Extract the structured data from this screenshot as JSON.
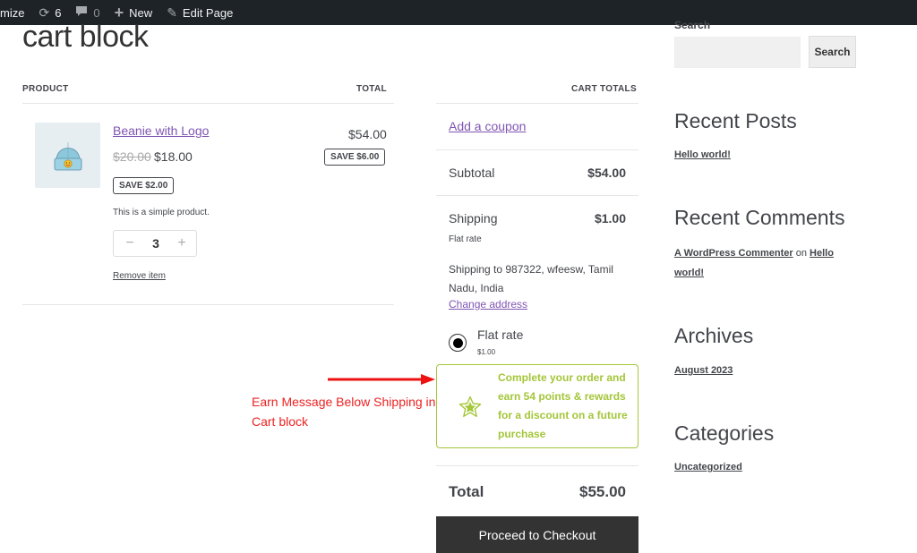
{
  "admin_bar": {
    "customize_label": "mize",
    "updates_count": "6",
    "comments_count": "0",
    "new_label": "New",
    "edit_label": "Edit Page"
  },
  "page": {
    "title": "cart block"
  },
  "cart_items": {
    "headers": {
      "product": "PRODUCT",
      "total": "TOTAL"
    },
    "items": [
      {
        "name": "Beanie with Logo",
        "regular_price": "$20.00",
        "sale_price": "$18.00",
        "item_savings": "SAVE $2.00",
        "description": "This is a simple product.",
        "quantity": "3",
        "line_total": "$54.00",
        "line_savings": "SAVE $6.00",
        "remove_label": "Remove item",
        "image": "beanie-icon"
      }
    ],
    "qty_minus": "−",
    "qty_plus": "+"
  },
  "cart_totals": {
    "heading": "CART TOTALS",
    "coupon_label": "Add a coupon",
    "subtotal_label": "Subtotal",
    "subtotal_value": "$54.00",
    "shipping_label": "Shipping",
    "shipping_value": "$1.00",
    "shipping_method": "Flat rate",
    "shipping_to": "Shipping to 987322, wfeesw, Tamil Nadu, India",
    "change_address": "Change address",
    "rate_option": {
      "label": "Flat rate",
      "price": "$1.00",
      "selected": true
    },
    "earn_message": "Complete your order and earn 54 points & rewards for a discount on a future purchase",
    "total_label": "Total",
    "total_value": "$55.00",
    "checkout_label": "Proceed to Checkout",
    "accent_color": "#a4c639"
  },
  "annotation": {
    "text": "Earn Message Below Shipping in Cart block",
    "color": "#ee2222"
  },
  "sidebar": {
    "search": {
      "label": "Search",
      "placeholder": "",
      "button": "Search"
    },
    "recent_posts": {
      "title": "Recent Posts",
      "items": [
        "Hello world!"
      ]
    },
    "recent_comments": {
      "title": "Recent Comments",
      "author": "A WordPress Commenter",
      "on": "on",
      "post": "Hello world!"
    },
    "archives": {
      "title": "Archives",
      "items": [
        "August 2023"
      ]
    },
    "categories": {
      "title": "Categories",
      "items": [
        "Uncategorized"
      ]
    }
  }
}
